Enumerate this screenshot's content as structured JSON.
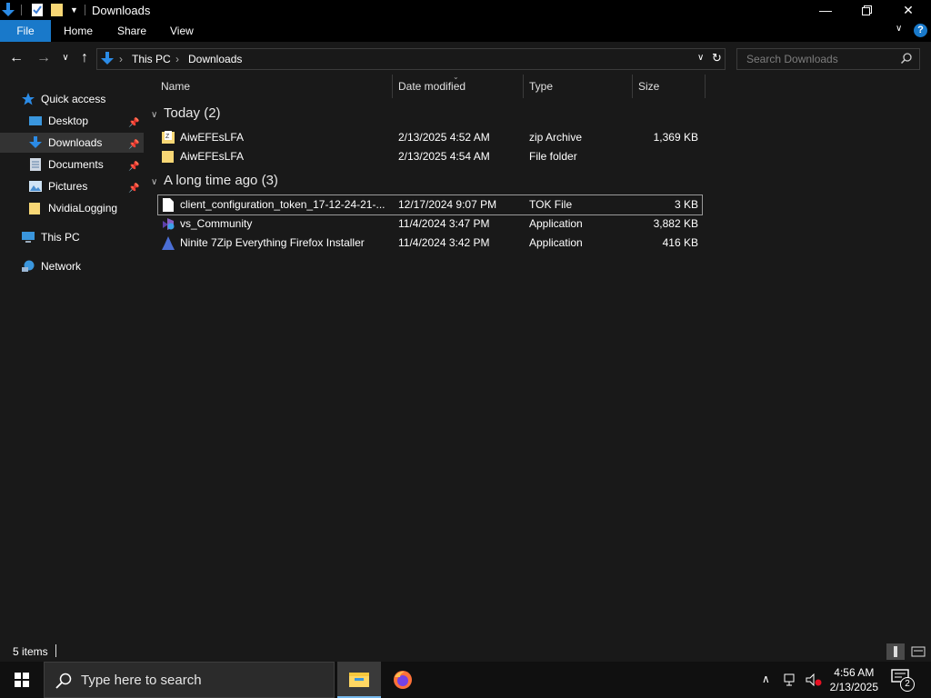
{
  "window": {
    "title": "Downloads"
  },
  "ribbon": {
    "tabs": [
      {
        "label": "File"
      },
      {
        "label": "Home"
      },
      {
        "label": "Share"
      },
      {
        "label": "View"
      }
    ]
  },
  "address": {
    "crumbs": [
      "This PC",
      "Downloads"
    ]
  },
  "search": {
    "placeholder": "Search Downloads"
  },
  "nav": {
    "quick_access": "Quick access",
    "items": [
      {
        "label": "Desktop",
        "icon": "desktop-icon",
        "pinned": true
      },
      {
        "label": "Downloads",
        "icon": "downloads-icon",
        "pinned": true,
        "selected": true
      },
      {
        "label": "Documents",
        "icon": "documents-icon",
        "pinned": true
      },
      {
        "label": "Pictures",
        "icon": "pictures-icon",
        "pinned": true
      },
      {
        "label": "NvidiaLogging",
        "icon": "folder-icon",
        "pinned": false
      }
    ],
    "this_pc": "This PC",
    "network": "Network"
  },
  "columns": {
    "name": "Name",
    "date": "Date modified",
    "type": "Type",
    "size": "Size"
  },
  "groups": [
    {
      "label": "Today (2)",
      "files": [
        {
          "name": "AiwEFEsLFA",
          "date": "2/13/2025 4:52 AM",
          "type": "zip Archive",
          "size": "1,369 KB",
          "icon": "zip-icon"
        },
        {
          "name": "AiwEFEsLFA",
          "date": "2/13/2025 4:54 AM",
          "type": "File folder",
          "size": "",
          "icon": "folder-icon"
        }
      ]
    },
    {
      "label": "A long time ago (3)",
      "files": [
        {
          "name": "client_configuration_token_17-12-24-21-...",
          "date": "12/17/2024 9:07 PM",
          "type": "TOK File",
          "size": "3 KB",
          "icon": "file-icon"
        },
        {
          "name": "vs_Community",
          "date": "11/4/2024 3:47 PM",
          "type": "Application",
          "size": "3,882 KB",
          "icon": "visual-studio-icon"
        },
        {
          "name": "Ninite 7Zip Everything Firefox Installer",
          "date": "11/4/2024 3:42 PM",
          "type": "Application",
          "size": "416 KB",
          "icon": "ninite-icon"
        }
      ]
    }
  ],
  "status": {
    "items": "5 items"
  },
  "taskbar": {
    "search_placeholder": "Type here to search",
    "time": "4:56 AM",
    "date": "2/13/2025",
    "notifications": "2"
  },
  "colors": {
    "accent": "#1979ca",
    "background": "#191919",
    "folder": "#f8d775"
  }
}
